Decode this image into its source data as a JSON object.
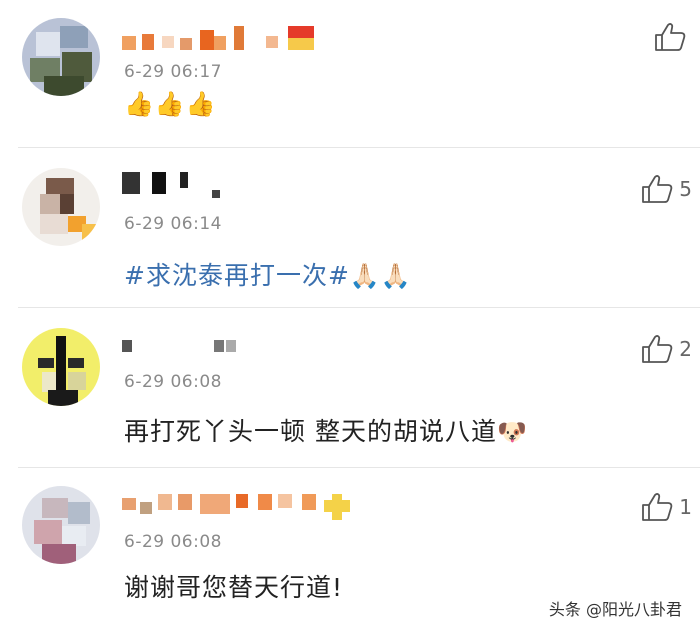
{
  "comments": [
    {
      "time": "6-29 06:17",
      "text": "",
      "emoji": "👍👍👍",
      "likes": ""
    },
    {
      "time": "6-29 06:14",
      "text": "#求沈泰再打一次#",
      "emoji": "🙏🏻🙏🏻",
      "likes": "5"
    },
    {
      "time": "6-29 06:08",
      "text": "再打死丫头一顿 整天的胡说八道",
      "emoji": "🐶",
      "likes": "2"
    },
    {
      "time": "6-29 06:08",
      "text": "谢谢哥您替天行道!",
      "emoji": "",
      "likes": "1"
    }
  ],
  "watermark": "头条 @阳光八卦君",
  "icons": {
    "like": "thumbs-up-icon"
  },
  "colors": {
    "topic": "#3a6fae",
    "time": "#8a8a8a"
  }
}
